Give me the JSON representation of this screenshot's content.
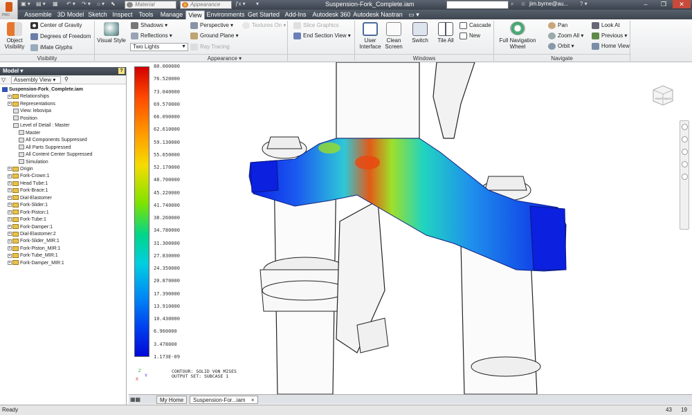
{
  "titlebar": {
    "app_logo_text": "PRO",
    "material_placeholder": "Material",
    "appearance_placeholder": "Appearance",
    "document_title": "Suspension-Fork_Complete.iam",
    "user": "jim.byrne@au...",
    "window_controls": [
      "–",
      "❐",
      "✕"
    ]
  },
  "tabs": [
    "Assemble",
    "3D Model",
    "Sketch",
    "Inspect",
    "Tools",
    "Manage",
    "View",
    "Environments",
    "Get Started",
    "Add-Ins",
    "Autodesk 360",
    "Autodesk Nastran"
  ],
  "active_tab": "View",
  "ribbon": {
    "visibility": {
      "label": "Visibility",
      "object_visibility": "Object Visibility",
      "center_of_gravity": "Center of Gravity",
      "degrees_of_freedom": "Degrees of Freedom",
      "imate_glyphs": "iMate Glyphs"
    },
    "appearance": {
      "label": "Appearance ▾",
      "visual_style": "Visual Style",
      "shadows": "Shadows ▾",
      "reflections": "Reflections ▾",
      "lighting": "Two Lights",
      "perspective": "Perspective ▾",
      "ground_plane": "Ground Plane ▾",
      "ray_tracing": "Ray Tracing",
      "textures_on": "Textures On ▾",
      "slice_graphics": "Slice Graphics",
      "end_section_view": "End Section View ▾"
    },
    "windows": {
      "label": "Windows",
      "user_interface": "User Interface",
      "clean_screen": "Clean Screen",
      "switch": "Switch",
      "tile_all": "Tile All",
      "cascade": "Cascade",
      "new": "New"
    },
    "navigate": {
      "label": "Navigate",
      "full_navigation_wheel": "Full Navigation Wheel",
      "pan": "Pan",
      "zoom_all": "Zoom All ▾",
      "orbit": "Orbit ▾",
      "look_at": "Look At",
      "previous": "Previous ▾",
      "home_view": "Home View"
    }
  },
  "browser": {
    "title": "Model ▾",
    "help": "?",
    "view_mode": "Assembly View ▾",
    "tree": [
      {
        "label": "Suspension-Fork_Complete.iam",
        "indent": 0,
        "icon": "assembly"
      },
      {
        "label": "Relationships",
        "indent": 1,
        "icon": "folder"
      },
      {
        "label": "Representations",
        "indent": 1,
        "icon": "folder"
      },
      {
        "label": "View: lebovipa",
        "indent": 2,
        "icon": "rep"
      },
      {
        "label": "Position",
        "indent": 2,
        "icon": "rep"
      },
      {
        "label": "Level of Detail : Master",
        "indent": 2,
        "icon": "rep"
      },
      {
        "label": "Master",
        "indent": 3,
        "icon": "check"
      },
      {
        "label": "All Components Suppressed",
        "indent": 3,
        "icon": "rep"
      },
      {
        "label": "All Parts Suppressed",
        "indent": 3,
        "icon": "rep"
      },
      {
        "label": "All Content Center Suppressed",
        "indent": 3,
        "icon": "rep"
      },
      {
        "label": "Simulation",
        "indent": 3,
        "icon": "rep"
      },
      {
        "label": "Origin",
        "indent": 1,
        "icon": "folder"
      },
      {
        "label": "Fork-Crown:1",
        "indent": 1,
        "icon": "part"
      },
      {
        "label": "Head Tube:1",
        "indent": 1,
        "icon": "part"
      },
      {
        "label": "Fork-Brace:1",
        "indent": 1,
        "icon": "part"
      },
      {
        "label": "Dial-Elastomer",
        "indent": 1,
        "icon": "part"
      },
      {
        "label": "Fork-Slider:1",
        "indent": 1,
        "icon": "part"
      },
      {
        "label": "Fork-Piston:1",
        "indent": 1,
        "icon": "part"
      },
      {
        "label": "Fork-Tube:1",
        "indent": 1,
        "icon": "part"
      },
      {
        "label": "Fork-Damper:1",
        "indent": 1,
        "icon": "part"
      },
      {
        "label": "Dial-Elastomer:2",
        "indent": 1,
        "icon": "part"
      },
      {
        "label": "Fork-Slider_MIR:1",
        "indent": 1,
        "icon": "part"
      },
      {
        "label": "Fork-Piston_MIR:1",
        "indent": 1,
        "icon": "part"
      },
      {
        "label": "Fork-Tube_MIR:1",
        "indent": 1,
        "icon": "part"
      },
      {
        "label": "Fork-Damper_MIR:1",
        "indent": 1,
        "icon": "part"
      }
    ]
  },
  "legend": {
    "values": [
      "80.000000",
      "76.520000",
      "73.040000",
      "69.570000",
      "66.090000",
      "62.610000",
      "59.130000",
      "55.650000",
      "52.170000",
      "48.700000",
      "45.220000",
      "41.740000",
      "38.260000",
      "34.780000",
      "31.300000",
      "27.830000",
      "24.350000",
      "20.870000",
      "17.390000",
      "13.910000",
      "10.430000",
      "6.960000",
      "3.478000",
      "1.173E-09"
    ],
    "caption_line1": "CONTOUR: SOLID VON MISES",
    "caption_line2": "OUTPUT SET: SUBCASE 1"
  },
  "viewcube_labels": [
    "RIGHT",
    "BACK"
  ],
  "triad": {
    "z": "Z",
    "y": "Y",
    "x": "X"
  },
  "doc_tabs": [
    "My Home",
    "Suspension-For...iam"
  ],
  "status": {
    "ready": "Ready",
    "count_a": "43",
    "count_b": "19"
  }
}
